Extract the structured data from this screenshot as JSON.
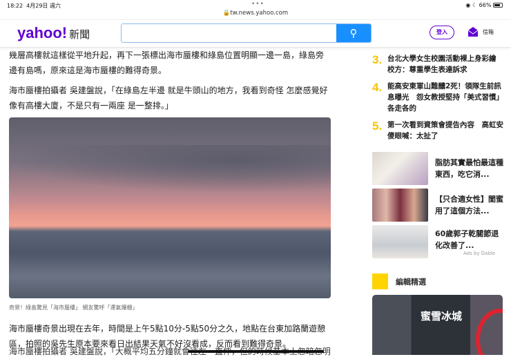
{
  "status": {
    "time": "18:22",
    "date": "4月29日 週六",
    "battery": "66%",
    "url": "tw.news.yahoo.com"
  },
  "header": {
    "logo": "yahoo!",
    "logo_sub": "新聞",
    "search_placeholder": "",
    "login": "登入",
    "mail": "信箱"
  },
  "article": {
    "paragraphs": [
      "幾層高樓就這樣從平地升起，再下一張標出海市蜃樓和綠島位置明顯一邊一島，綠島旁邊有島嗎，原來這是海市蜃樓的難得奇景。",
      "海市蜃樓拍攝者 吳建盤說，「在綠島左半邊 就是牛頭山的地方，我看到奇怪 怎麼感覺好像有高樓大廈，不是只有一兩座 是一整排。」"
    ],
    "caption": "奇景！綠島驚見「海市蜃樓」 網友驚呼「運氣爆棚」",
    "paragraph3": "海市蜃樓奇景出現在去年，時間是上午5點10分-5點50分之久，地點在台東加路蘭遊憩區，拍照的吳先生原本要來看日出結果天氣不好沒看成，反而看到難得奇景。",
    "cut_line": "海市蜃樓拍攝者 吳建盤說，「大概平均五分鐘就會往左一直伸，但的時候基本上忽暗忽明，"
  },
  "sidebar": {
    "trending": [
      {
        "num": "3.",
        "title": "台北大學女生校園活動裸上身彩繪 校方：尊重學生表達訴求"
      },
      {
        "num": "4.",
        "title": "能高安東軍山難釀2死！領隊生前訊息曝光　怨女教授堅持「美式習慣」各走各的"
      },
      {
        "num": "5.",
        "title": "第一次看到資策會提告內容　高虹安傻眼喊：太扯了"
      }
    ],
    "ads": [
      {
        "title": "脂肪其實最怕最這種東西，吃它消..."
      },
      {
        "title": "【只合適女性】閨蜜用了這個方法..."
      },
      {
        "title": "60歲郭子乾關節退化改善了..."
      }
    ],
    "ads_by": "Ads by Dable",
    "editor_title": "編輯精選",
    "editor_image_sign": "蜜雪冰城"
  }
}
